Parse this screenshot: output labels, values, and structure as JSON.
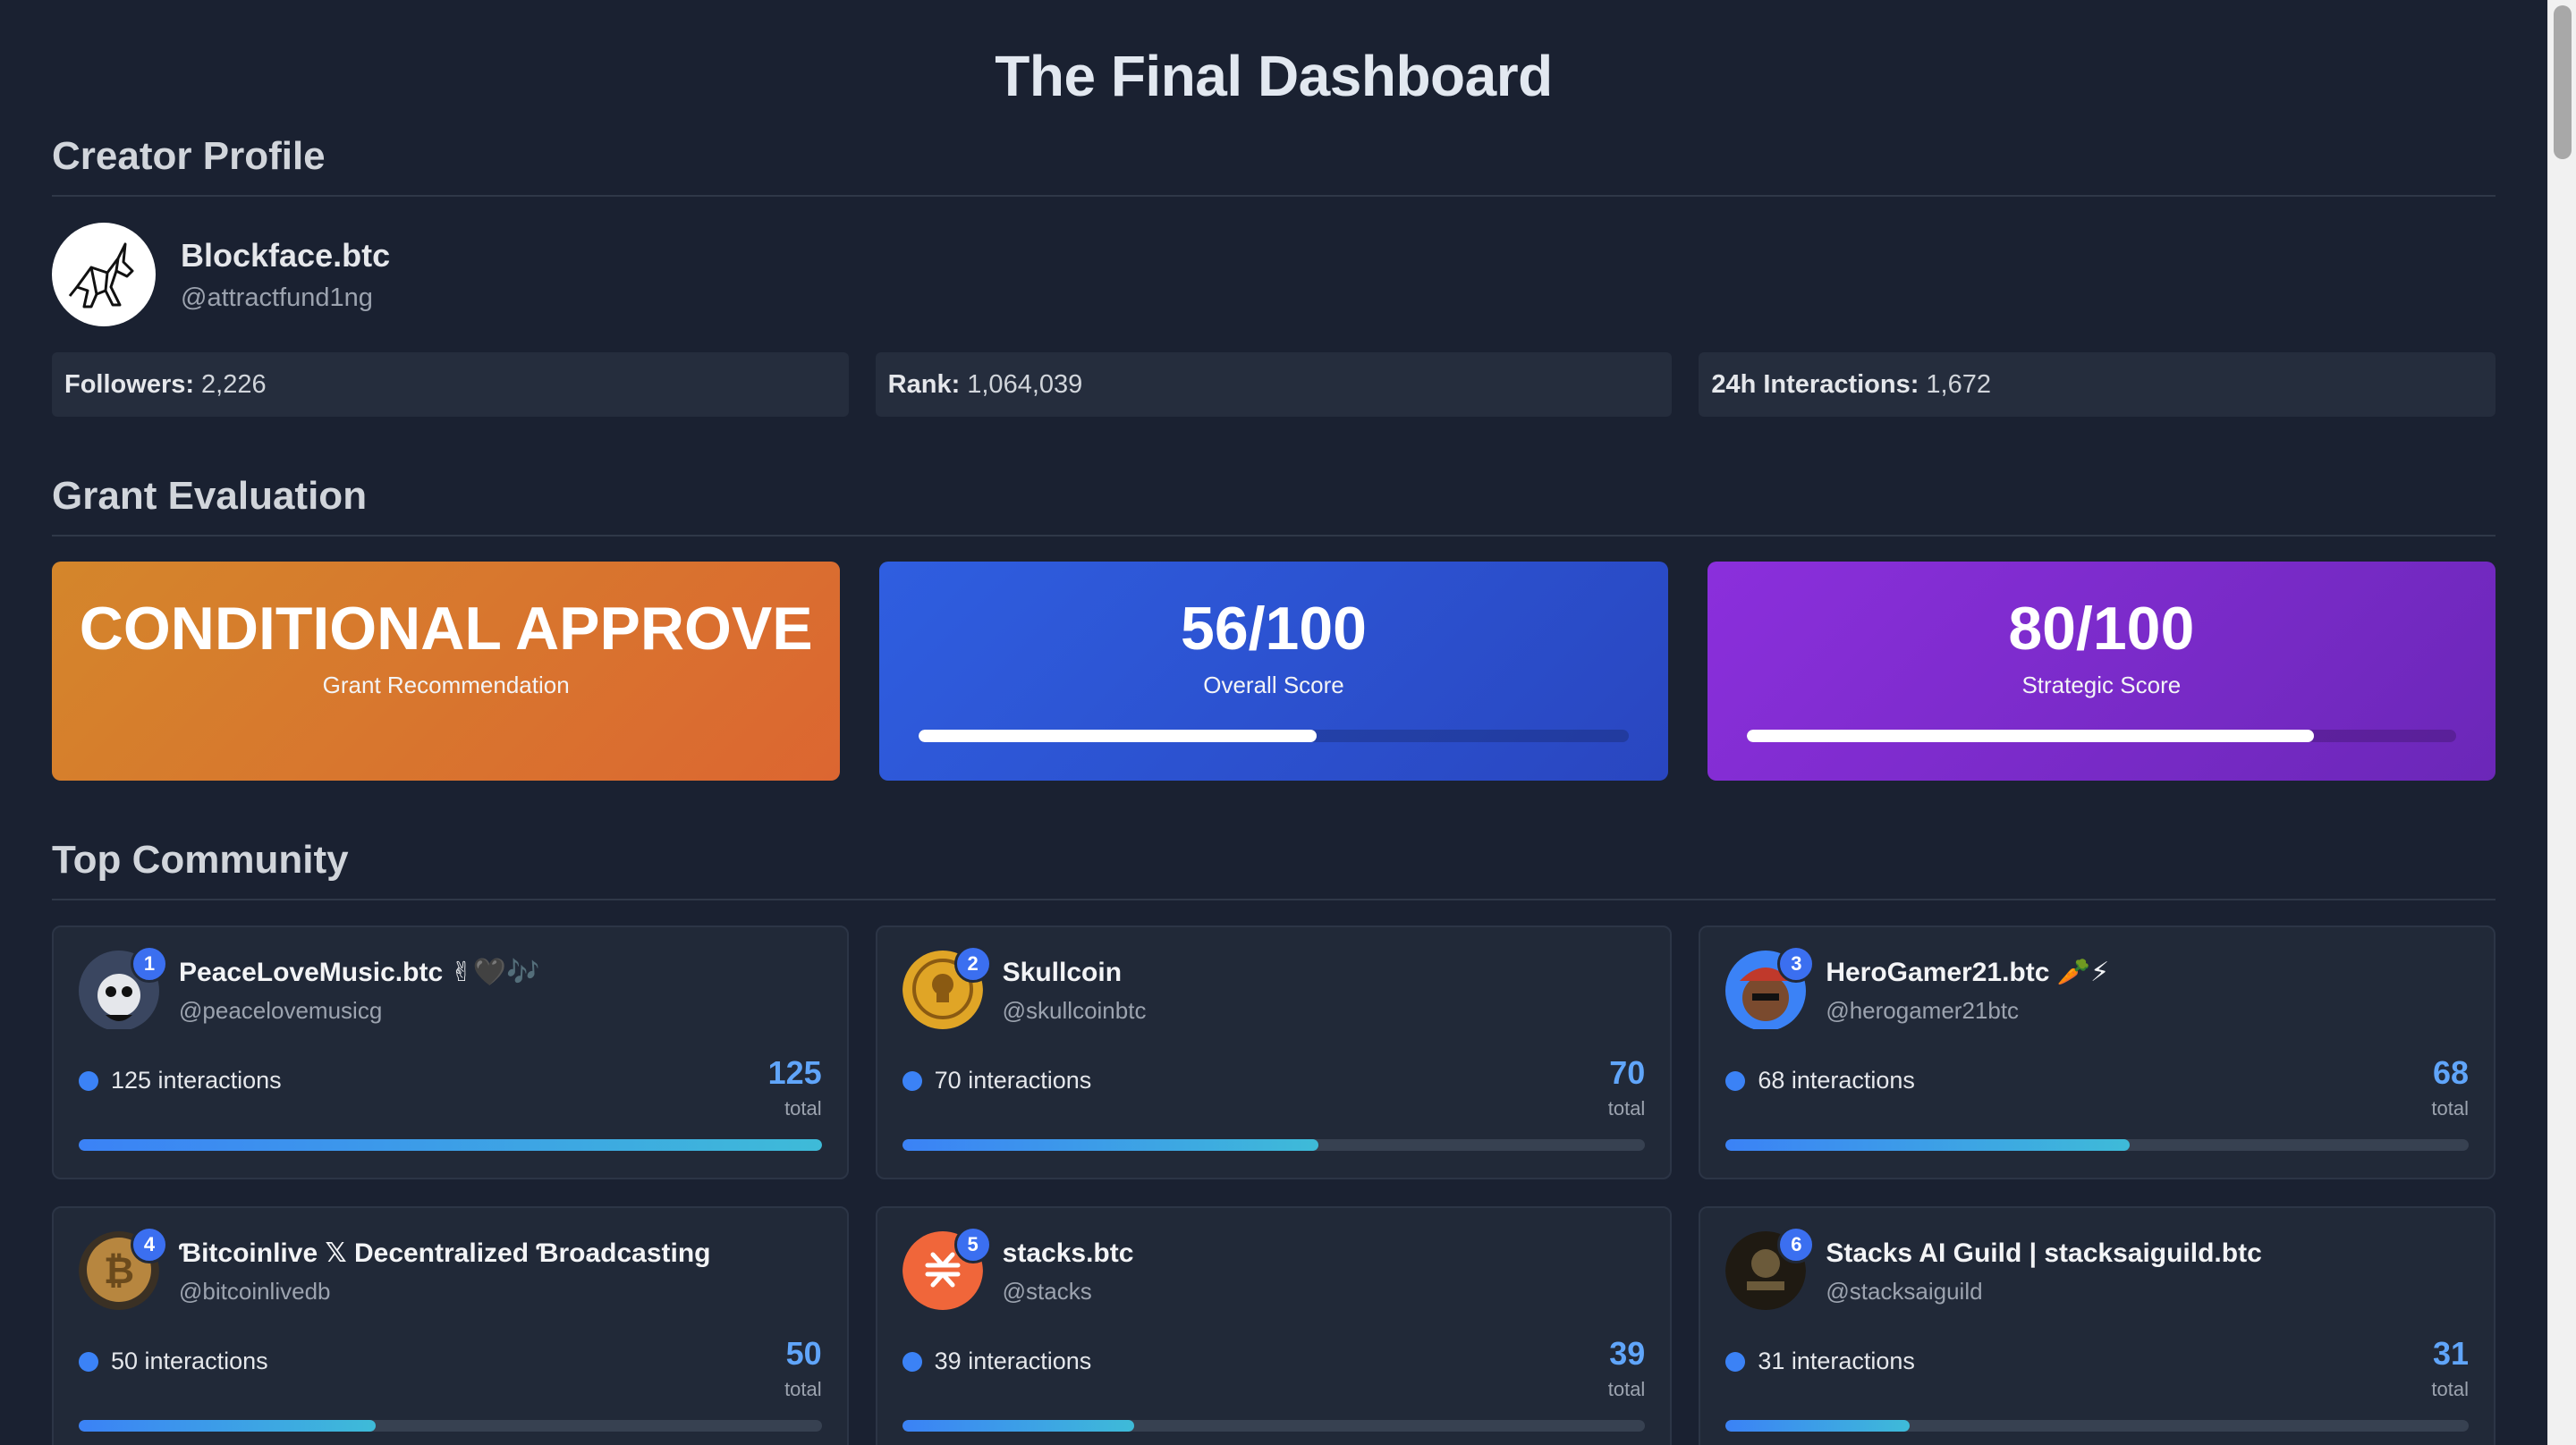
{
  "title": "The Final Dashboard",
  "profile": {
    "section": "Creator Profile",
    "name": "Blockface.btc",
    "handle": "@attractfund1ng",
    "stats": [
      {
        "label": "Followers:",
        "value": "2,226"
      },
      {
        "label": "Rank:",
        "value": "1,064,039"
      },
      {
        "label": "24h Interactions:",
        "value": "1,672"
      }
    ]
  },
  "grant": {
    "section": "Grant Evaluation",
    "cards": [
      {
        "big": "CONDITIONAL APPROVE",
        "sub": "Grant Recommendation",
        "color": "#d97a2e"
      },
      {
        "big": "56/100",
        "sub": "Overall Score",
        "progress": 0.56,
        "color": "#2f5ee0"
      },
      {
        "big": "80/100",
        "sub": "Strategic Score",
        "progress": 0.8,
        "color": "#8b2fdc"
      }
    ]
  },
  "community": {
    "section": "Top Community",
    "members": [
      {
        "rank": "1",
        "name": "PeaceLoveMusic.btc ✌🖤🎶",
        "handle": "@peacelovemusicg",
        "interactions": "125 interactions",
        "total": "125",
        "total_label": "total",
        "progress": 1.0,
        "avatar_icon": "panda-avatar-icon",
        "avatar_color": "#e5e7eb"
      },
      {
        "rank": "2",
        "name": "Skullcoin",
        "handle": "@skullcoinbtc",
        "interactions": "70 interactions",
        "total": "70",
        "total_label": "total",
        "progress": 0.56,
        "avatar_icon": "skull-coin-avatar-icon",
        "avatar_color": "#e0a526"
      },
      {
        "rank": "3",
        "name": "HeroGamer21.btc 🥕⚡",
        "handle": "@herogamer21btc",
        "interactions": "68 interactions",
        "total": "68",
        "total_label": "total",
        "progress": 0.544,
        "avatar_icon": "gamer-avatar-icon",
        "avatar_color": "#c0392b"
      },
      {
        "rank": "4",
        "name": "Ɓitcoinlive 𝕏 Decentralized Ɓroadcasting",
        "handle": "@bitcoinlivedb",
        "interactions": "50 interactions",
        "total": "50",
        "total_label": "total",
        "progress": 0.4,
        "avatar_icon": "bitcoin-coin-avatar-icon",
        "avatar_color": "#b7863f"
      },
      {
        "rank": "5",
        "name": "stacks.btc",
        "handle": "@stacks",
        "interactions": "39 interactions",
        "total": "39",
        "total_label": "total",
        "progress": 0.312,
        "avatar_icon": "stacks-logo-avatar-icon",
        "avatar_color": "#f0663a"
      },
      {
        "rank": "6",
        "name": "Stacks AI Guild | stacksaiguild.btc",
        "handle": "@stacksaiguild",
        "interactions": "31 interactions",
        "total": "31",
        "total_label": "total",
        "progress": 0.248,
        "avatar_icon": "ai-guild-avatar-icon",
        "avatar_color": "#1f1a12"
      }
    ]
  }
}
